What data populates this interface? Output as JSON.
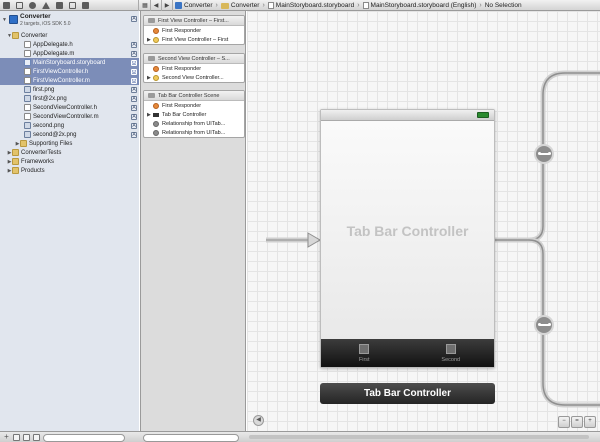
{
  "toolbar": {
    "nav_icons": [
      "folder-icon",
      "symbol-icon",
      "search-icon",
      "warning-icon",
      "debug-icon",
      "breakpoint-icon",
      "log-icon"
    ],
    "breadcrumbs": [
      "Converter",
      "Converter",
      "MainStoryboard.storyboard",
      "MainStoryboard.storyboard (English)",
      "No Selection"
    ]
  },
  "navigator": {
    "project": {
      "name": "Converter",
      "subtitle": "2 targets, iOS SDK 5.0",
      "badge": "A"
    },
    "rows": [
      {
        "label": "Converter",
        "type": "folder",
        "tri": "▼",
        "badge": ""
      },
      {
        "label": "AppDelegate.h",
        "type": "h",
        "badge": "A"
      },
      {
        "label": "AppDelegate.m",
        "type": "m",
        "badge": "A"
      },
      {
        "label": "MainStoryboard.storyboard",
        "type": "story",
        "badge": "A"
      },
      {
        "label": "FirstViewController.h",
        "type": "h",
        "badge": "A"
      },
      {
        "label": "FirstViewController.m",
        "type": "m",
        "badge": "A"
      },
      {
        "label": "first.png",
        "type": "png",
        "badge": "A"
      },
      {
        "label": "first@2x.png",
        "type": "png",
        "badge": "A"
      },
      {
        "label": "SecondViewController.h",
        "type": "h",
        "badge": "A"
      },
      {
        "label": "SecondViewController.m",
        "type": "m",
        "badge": "A"
      },
      {
        "label": "second.png",
        "type": "png",
        "badge": "A"
      },
      {
        "label": "second@2x.png",
        "type": "png",
        "badge": "A"
      },
      {
        "label": "Supporting Files",
        "type": "folder",
        "tri": "▶",
        "badge": ""
      },
      {
        "label": "ConverterTests",
        "type": "folder",
        "tri": "▶",
        "badge": ""
      },
      {
        "label": "Frameworks",
        "type": "folder",
        "tri": "▶",
        "badge": ""
      },
      {
        "label": "Products",
        "type": "folder",
        "tri": "▶",
        "badge": ""
      }
    ]
  },
  "outline": {
    "scenes": [
      {
        "title": "First View Controller – First...",
        "rows": [
          {
            "label": "First Responder",
            "icon": "first-responder-icon",
            "tri": ""
          },
          {
            "label": "First View Controller – First",
            "icon": "view-controller-icon",
            "tri": "▶"
          }
        ]
      },
      {
        "title": "Second View Controller – S...",
        "rows": [
          {
            "label": "First Responder",
            "icon": "first-responder-icon",
            "tri": ""
          },
          {
            "label": "Second View Controller...",
            "icon": "view-controller-icon",
            "tri": "▶"
          }
        ]
      },
      {
        "title": "Tab Bar Controller Scene",
        "rows": [
          {
            "label": "First Responder",
            "icon": "first-responder-icon",
            "tri": ""
          },
          {
            "label": "Tab Bar Controller",
            "icon": "tab-bar-controller-icon",
            "tri": "▶"
          },
          {
            "label": "Relationship from UITab...",
            "icon": "relationship-icon",
            "tri": ""
          },
          {
            "label": "Relationship from UITab...",
            "icon": "relationship-icon",
            "tri": ""
          }
        ]
      }
    ]
  },
  "canvas": {
    "placeholder": "Tab Bar Controller",
    "tabs": [
      {
        "label": "First"
      },
      {
        "label": "Second"
      }
    ],
    "scene_name": "Tab Bar Controller"
  },
  "colors": {
    "selection": "#7c8db8",
    "navigator_bg": "#e1e6ee",
    "canvas_grid": "#e4e4e4",
    "tabbar": "#111111"
  }
}
